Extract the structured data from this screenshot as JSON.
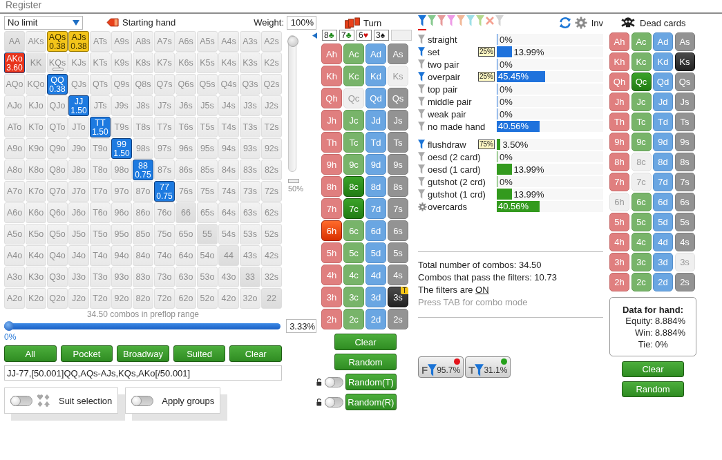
{
  "menu": {
    "item": "Register"
  },
  "range_panel": {
    "limit_dropdown": "No limit",
    "starting_hand": "Starting hand",
    "weight_label": "Weight:",
    "weight_value": "100%",
    "weight_slider": {
      "level": 1
    },
    "mini_bar": {
      "reading": "50%"
    },
    "hand_grid": {
      "rows": [
        [
          {
            "label": "AA",
            "selected": false
          },
          {
            "label": "AKs",
            "selected": false
          },
          {
            "label": "AQs",
            "selected": true,
            "weight": "0.38",
            "color": "#f3c41a"
          },
          {
            "label": "AJs",
            "selected": true,
            "weight": "0.38",
            "color": "#f3c41a"
          },
          {
            "label": "ATs",
            "selected": false
          },
          {
            "label": "A9s",
            "selected": false
          },
          {
            "label": "A8s",
            "selected": false
          },
          {
            "label": "A7s",
            "selected": false
          },
          {
            "label": "A6s",
            "selected": false
          },
          {
            "label": "A5s",
            "selected": false
          },
          {
            "label": "A4s",
            "selected": false
          },
          {
            "label": "A3s",
            "selected": false
          },
          {
            "label": "A2s",
            "selected": false
          }
        ],
        [
          {
            "label": "AKo",
            "selected": true,
            "weight": "3.60",
            "color": "#e8341c"
          },
          {
            "label": "KK",
            "selected": false
          },
          {
            "label": "KQs",
            "selected": false,
            "level": 0
          },
          {
            "label": "KJs",
            "selected": false
          },
          {
            "label": "KTs",
            "selected": false
          },
          {
            "label": "K9s",
            "selected": false
          },
          {
            "label": "K8s",
            "selected": false
          },
          {
            "label": "K7s",
            "selected": false
          },
          {
            "label": "K6s",
            "selected": false
          },
          {
            "label": "K5s",
            "selected": false
          },
          {
            "label": "K4s",
            "selected": false
          },
          {
            "label": "K3s",
            "selected": false
          },
          {
            "label": "K2s",
            "selected": false
          }
        ],
        [
          {
            "label": "AQo",
            "selected": false
          },
          {
            "label": "KQo",
            "selected": false
          },
          {
            "label": "QQ",
            "selected": true,
            "weight": "0.38",
            "color": "#1d7ae0"
          },
          {
            "label": "QJs",
            "selected": false
          },
          {
            "label": "QTs",
            "selected": false
          },
          {
            "label": "Q9s",
            "selected": false
          },
          {
            "label": "Q8s",
            "selected": false
          },
          {
            "label": "Q7s",
            "selected": false
          },
          {
            "label": "Q6s",
            "selected": false
          },
          {
            "label": "Q5s",
            "selected": false
          },
          {
            "label": "Q4s",
            "selected": false
          },
          {
            "label": "Q3s",
            "selected": false
          },
          {
            "label": "Q2s",
            "selected": false
          }
        ],
        [
          {
            "label": "AJo",
            "selected": false
          },
          {
            "label": "KJo",
            "selected": false
          },
          {
            "label": "QJo",
            "selected": false
          },
          {
            "label": "JJ",
            "selected": true,
            "weight": "1.50",
            "color": "#1d7ae0"
          },
          {
            "label": "JTs",
            "selected": false
          },
          {
            "label": "J9s",
            "selected": false
          },
          {
            "label": "J8s",
            "selected": false
          },
          {
            "label": "J7s",
            "selected": false
          },
          {
            "label": "J6s",
            "selected": false
          },
          {
            "label": "J5s",
            "selected": false
          },
          {
            "label": "J4s",
            "selected": false
          },
          {
            "label": "J3s",
            "selected": false
          },
          {
            "label": "J2s",
            "selected": false
          }
        ],
        [
          {
            "label": "ATo",
            "selected": false
          },
          {
            "label": "KTo",
            "selected": false
          },
          {
            "label": "QTo",
            "selected": false
          },
          {
            "label": "JTo",
            "selected": false
          },
          {
            "label": "TT",
            "selected": true,
            "weight": "1.50",
            "color": "#1d7ae0"
          },
          {
            "label": "T9s",
            "selected": false
          },
          {
            "label": "T8s",
            "selected": false
          },
          {
            "label": "T7s",
            "selected": false
          },
          {
            "label": "T6s",
            "selected": false
          },
          {
            "label": "T5s",
            "selected": false
          },
          {
            "label": "T4s",
            "selected": false
          },
          {
            "label": "T3s",
            "selected": false
          },
          {
            "label": "T2s",
            "selected": false
          }
        ],
        [
          {
            "label": "A9o",
            "selected": false
          },
          {
            "label": "K9o",
            "selected": false
          },
          {
            "label": "Q9o",
            "selected": false
          },
          {
            "label": "J9o",
            "selected": false
          },
          {
            "label": "T9o",
            "selected": false
          },
          {
            "label": "99",
            "selected": true,
            "weight": "1.50",
            "color": "#1d7ae0"
          },
          {
            "label": "98s",
            "selected": false
          },
          {
            "label": "97s",
            "selected": false
          },
          {
            "label": "96s",
            "selected": false
          },
          {
            "label": "95s",
            "selected": false
          },
          {
            "label": "94s",
            "selected": false
          },
          {
            "label": "93s",
            "selected": false
          },
          {
            "label": "92s",
            "selected": false
          }
        ],
        [
          {
            "label": "A8o",
            "selected": false
          },
          {
            "label": "K8o",
            "selected": false
          },
          {
            "label": "Q8o",
            "selected": false
          },
          {
            "label": "J8o",
            "selected": false
          },
          {
            "label": "T8o",
            "selected": false
          },
          {
            "label": "98o",
            "selected": false
          },
          {
            "label": "88",
            "selected": true,
            "weight": "0.75",
            "color": "#1d7ae0"
          },
          {
            "label": "87s",
            "selected": false
          },
          {
            "label": "86s",
            "selected": false
          },
          {
            "label": "85s",
            "selected": false
          },
          {
            "label": "84s",
            "selected": false
          },
          {
            "label": "83s",
            "selected": false
          },
          {
            "label": "82s",
            "selected": false
          }
        ],
        [
          {
            "label": "A7o",
            "selected": false
          },
          {
            "label": "K7o",
            "selected": false
          },
          {
            "label": "Q7o",
            "selected": false
          },
          {
            "label": "J7o",
            "selected": false
          },
          {
            "label": "T7o",
            "selected": false
          },
          {
            "label": "97o",
            "selected": false
          },
          {
            "label": "87o",
            "selected": false
          },
          {
            "label": "77",
            "selected": true,
            "weight": "0.75",
            "color": "#1d7ae0"
          },
          {
            "label": "76s",
            "selected": false
          },
          {
            "label": "75s",
            "selected": false
          },
          {
            "label": "74s",
            "selected": false
          },
          {
            "label": "73s",
            "selected": false
          },
          {
            "label": "72s",
            "selected": false
          }
        ],
        [
          {
            "label": "A6o",
            "selected": false
          },
          {
            "label": "K6o",
            "selected": false
          },
          {
            "label": "Q6o",
            "selected": false
          },
          {
            "label": "J6o",
            "selected": false
          },
          {
            "label": "T6o",
            "selected": false
          },
          {
            "label": "96o",
            "selected": false
          },
          {
            "label": "86o",
            "selected": false
          },
          {
            "label": "76o",
            "selected": false
          },
          {
            "label": "66",
            "selected": false
          },
          {
            "label": "65s",
            "selected": false
          },
          {
            "label": "64s",
            "selected": false
          },
          {
            "label": "63s",
            "selected": false
          },
          {
            "label": "62s",
            "selected": false
          }
        ],
        [
          {
            "label": "A5o",
            "selected": false
          },
          {
            "label": "K5o",
            "selected": false
          },
          {
            "label": "Q5o",
            "selected": false
          },
          {
            "label": "J5o",
            "selected": false
          },
          {
            "label": "T5o",
            "selected": false
          },
          {
            "label": "95o",
            "selected": false
          },
          {
            "label": "85o",
            "selected": false
          },
          {
            "label": "75o",
            "selected": false
          },
          {
            "label": "65o",
            "selected": false
          },
          {
            "label": "55",
            "selected": false
          },
          {
            "label": "54s",
            "selected": false
          },
          {
            "label": "53s",
            "selected": false
          },
          {
            "label": "52s",
            "selected": false
          }
        ],
        [
          {
            "label": "A4o",
            "selected": false
          },
          {
            "label": "K4o",
            "selected": false
          },
          {
            "label": "Q4o",
            "selected": false
          },
          {
            "label": "J4o",
            "selected": false
          },
          {
            "label": "T4o",
            "selected": false
          },
          {
            "label": "94o",
            "selected": false
          },
          {
            "label": "84o",
            "selected": false
          },
          {
            "label": "74o",
            "selected": false
          },
          {
            "label": "64o",
            "selected": false
          },
          {
            "label": "54o",
            "selected": false
          },
          {
            "label": "44",
            "selected": false
          },
          {
            "label": "43s",
            "selected": false
          },
          {
            "label": "42s",
            "selected": false
          }
        ],
        [
          {
            "label": "A3o",
            "selected": false
          },
          {
            "label": "K3o",
            "selected": false
          },
          {
            "label": "Q3o",
            "selected": false
          },
          {
            "label": "J3o",
            "selected": false
          },
          {
            "label": "T3o",
            "selected": false
          },
          {
            "label": "93o",
            "selected": false
          },
          {
            "label": "83o",
            "selected": false
          },
          {
            "label": "73o",
            "selected": false
          },
          {
            "label": "63o",
            "selected": false
          },
          {
            "label": "53o",
            "selected": false
          },
          {
            "label": "43o",
            "selected": false
          },
          {
            "label": "33",
            "selected": false
          },
          {
            "label": "32s",
            "selected": false
          }
        ],
        [
          {
            "label": "A2o",
            "selected": false
          },
          {
            "label": "K2o",
            "selected": false
          },
          {
            "label": "Q2o",
            "selected": false
          },
          {
            "label": "J2o",
            "selected": false
          },
          {
            "label": "T2o",
            "selected": false
          },
          {
            "label": "92o",
            "selected": false
          },
          {
            "label": "82o",
            "selected": false
          },
          {
            "label": "72o",
            "selected": false
          },
          {
            "label": "62o",
            "selected": false
          },
          {
            "label": "52o",
            "selected": false
          },
          {
            "label": "42o",
            "selected": false
          },
          {
            "label": "32o",
            "selected": false
          },
          {
            "label": "22",
            "selected": false
          }
        ]
      ]
    },
    "combo_caption": "34.50 combos in preflop range",
    "range_slider": {
      "level": 0
    },
    "slider_reading": "0%",
    "percent_field": "3.33%",
    "buttons": [
      "All",
      "Pocket",
      "Broadway",
      "Suited",
      "Clear"
    ],
    "range_text": "JJ-77,[50.001]QQ,AQs-AJs,KQs,AKo[/50.001]",
    "toggles": [
      {
        "label": "Suit selection",
        "on": false,
        "kind": "suits"
      },
      {
        "label": "Apply groups",
        "on": false,
        "kind": "plain"
      }
    ]
  },
  "board": {
    "street": "Turn",
    "cards": [
      {
        "rank": "8",
        "suit": "♣",
        "kind": "clubs"
      },
      {
        "rank": "7",
        "suit": "♣",
        "kind": "clubs"
      },
      {
        "rank": "6",
        "suit": "♥",
        "kind": "hearts"
      },
      {
        "rank": "3",
        "suit": "♠",
        "kind": "spades"
      },
      {
        "kind": "empty"
      }
    ],
    "deck": {
      "suits": [
        {
          "kind": "hearts",
          "cards": [
            {
              "label": "Ah",
              "kind": "free"
            },
            {
              "label": "Kh",
              "kind": "free"
            },
            {
              "label": "Qh",
              "kind": "free"
            },
            {
              "label": "Jh",
              "kind": "free"
            },
            {
              "label": "Th",
              "kind": "free"
            },
            {
              "label": "9h",
              "kind": "free"
            },
            {
              "label": "8h",
              "kind": "free"
            },
            {
              "label": "7h",
              "kind": "free"
            },
            {
              "label": "6h",
              "kind": "board"
            },
            {
              "label": "5h",
              "kind": "free"
            },
            {
              "label": "4h",
              "kind": "free"
            },
            {
              "label": "3h",
              "kind": "free"
            },
            {
              "label": "2h",
              "kind": "free"
            }
          ]
        },
        {
          "kind": "clubs",
          "cards": [
            {
              "label": "Ac",
              "kind": "free"
            },
            {
              "label": "Kc",
              "kind": "free"
            },
            {
              "label": "Qc",
              "kind": "used"
            },
            {
              "label": "Jc",
              "kind": "free"
            },
            {
              "label": "Tc",
              "kind": "free"
            },
            {
              "label": "9c",
              "kind": "free"
            },
            {
              "label": "8c",
              "kind": "board"
            },
            {
              "label": "7c",
              "kind": "board"
            },
            {
              "label": "6c",
              "kind": "free"
            },
            {
              "label": "5c",
              "kind": "free"
            },
            {
              "label": "4c",
              "kind": "free"
            },
            {
              "label": "3c",
              "kind": "free"
            },
            {
              "label": "2c",
              "kind": "free"
            }
          ]
        },
        {
          "kind": "diamonds",
          "cards": [
            {
              "label": "Ad",
              "kind": "free"
            },
            {
              "label": "Kd",
              "kind": "free"
            },
            {
              "label": "Qd",
              "kind": "free"
            },
            {
              "label": "Jd",
              "kind": "free"
            },
            {
              "label": "Td",
              "kind": "free"
            },
            {
              "label": "9d",
              "kind": "free"
            },
            {
              "label": "8d",
              "kind": "free"
            },
            {
              "label": "7d",
              "kind": "free"
            },
            {
              "label": "6d",
              "kind": "free"
            },
            {
              "label": "5d",
              "kind": "free"
            },
            {
              "label": "4d",
              "kind": "free"
            },
            {
              "label": "3d",
              "kind": "free"
            },
            {
              "label": "2d",
              "kind": "free"
            }
          ]
        },
        {
          "kind": "spades",
          "cards": [
            {
              "label": "As",
              "kind": "free"
            },
            {
              "label": "Ks",
              "kind": "used"
            },
            {
              "label": "Qs",
              "kind": "free"
            },
            {
              "label": "Js",
              "kind": "free"
            },
            {
              "label": "Ts",
              "kind": "free"
            },
            {
              "label": "9s",
              "kind": "free"
            },
            {
              "label": "8s",
              "kind": "free"
            },
            {
              "label": "7s",
              "kind": "free"
            },
            {
              "label": "6s",
              "kind": "free"
            },
            {
              "label": "5s",
              "kind": "free"
            },
            {
              "label": "4s",
              "kind": "free"
            },
            {
              "label": "3s",
              "kind": "board",
              "badge": "T"
            },
            {
              "label": "2s",
              "kind": "free"
            }
          ]
        }
      ]
    },
    "buttons": [
      {
        "label": "Clear",
        "lock": false
      },
      {
        "label": "Random",
        "lock": false
      },
      {
        "label": "Random(T)",
        "lock": true,
        "on": false
      },
      {
        "label": "Random(R)",
        "lock": true,
        "on": false
      }
    ]
  },
  "filters": {
    "tabs": [
      {
        "kind": "funnel",
        "color": "#1a73d6",
        "selected": true
      },
      {
        "kind": "funnel",
        "color": "#86c98e",
        "selected": false
      },
      {
        "kind": "funnel",
        "color": "#e79a9a",
        "selected": false
      },
      {
        "kind": "funnel",
        "color": "#ee9ae6",
        "selected": false
      },
      {
        "kind": "funnel",
        "color": "#f1b898",
        "selected": false
      },
      {
        "kind": "funnel",
        "color": "#9ddfe6",
        "selected": false
      },
      {
        "kind": "funnel",
        "color": "#b6da8e",
        "selected": false
      },
      {
        "kind": "clear",
        "color": "#f5a090",
        "selected": false
      },
      {
        "kind": "funnel",
        "color": "#d4d4d4",
        "selected": false
      }
    ],
    "inv": "Inv",
    "groups": [
      {
        "color": "#1f72dc",
        "rows": [
          {
            "kind": "funnel",
            "label": "straight",
            "active": false,
            "level": 0,
            "reading": "0%"
          },
          {
            "kind": "funnel",
            "label": "set",
            "active": true,
            "badge": "25%",
            "level": 0.1399,
            "reading": "13.99%"
          },
          {
            "kind": "funnel",
            "label": "two pair",
            "active": false,
            "level": 0,
            "reading": "0%"
          },
          {
            "kind": "funnel",
            "label": "overpair",
            "active": true,
            "badge": "25%",
            "level": 0.4545,
            "reading": "45.45%"
          },
          {
            "kind": "funnel",
            "label": "top pair",
            "active": false,
            "level": 0,
            "reading": "0%"
          },
          {
            "kind": "funnel",
            "label": "middle pair",
            "active": false,
            "level": 0,
            "reading": "0%"
          },
          {
            "kind": "funnel",
            "label": "weak pair",
            "active": false,
            "level": 0,
            "reading": "0%"
          },
          {
            "kind": "funnel",
            "label": "no made hand",
            "active": false,
            "level": 0.4056,
            "reading": "40.56%"
          }
        ]
      },
      {
        "color": "#339a1e",
        "rows": [
          {
            "kind": "funnel",
            "label": "flushdraw",
            "active": true,
            "badge": "75%",
            "level": 0.035,
            "reading": "3.50%"
          },
          {
            "kind": "funnel",
            "label": "oesd (2 card)",
            "active": false,
            "level": 0,
            "reading": "0%"
          },
          {
            "kind": "funnel",
            "label": "oesd (1 card)",
            "active": false,
            "level": 0.1399,
            "reading": "13.99%"
          },
          {
            "kind": "funnel",
            "label": "gutshot (2 crd)",
            "active": false,
            "level": 0,
            "reading": "0%"
          },
          {
            "kind": "funnel",
            "label": "gutshot (1 crd)",
            "active": false,
            "level": 0.1399,
            "reading": "13.99%"
          },
          {
            "kind": "gear",
            "label": "overcards",
            "level": 0.4056,
            "reading": "40.56%"
          }
        ]
      }
    ],
    "total_combos": "Total number of combos: 34.50",
    "passing_combos": "Combos that pass the filters: 10.73",
    "filters_prefix": "The filters are",
    "filters_state": "ON",
    "hint": "Press TAB for combo mode",
    "badges": [
      {
        "letter": "F",
        "reading": "95.7%",
        "color": "#e3141c"
      },
      {
        "letter": "T",
        "reading": "31.1%",
        "color": "#25a11b"
      }
    ]
  },
  "dead_cards": {
    "title": "Dead cards",
    "deck": {
      "suits": [
        {
          "kind": "hearts",
          "cards": [
            {
              "label": "Ah",
              "kind": "free"
            },
            {
              "label": "Kh",
              "kind": "free"
            },
            {
              "label": "Qh",
              "kind": "free"
            },
            {
              "label": "Jh",
              "kind": "free"
            },
            {
              "label": "Th",
              "kind": "free"
            },
            {
              "label": "9h",
              "kind": "free"
            },
            {
              "label": "8h",
              "kind": "free"
            },
            {
              "label": "7h",
              "kind": "free"
            },
            {
              "label": "6h",
              "kind": "used"
            },
            {
              "label": "5h",
              "kind": "free"
            },
            {
              "label": "4h",
              "kind": "free"
            },
            {
              "label": "3h",
              "kind": "free"
            },
            {
              "label": "2h",
              "kind": "free"
            }
          ]
        },
        {
          "kind": "clubs",
          "cards": [
            {
              "label": "Ac",
              "kind": "free"
            },
            {
              "label": "Kc",
              "kind": "free"
            },
            {
              "label": "Qc",
              "kind": "dead"
            },
            {
              "label": "Jc",
              "kind": "free"
            },
            {
              "label": "Tc",
              "kind": "free"
            },
            {
              "label": "9c",
              "kind": "free"
            },
            {
              "label": "8c",
              "kind": "used"
            },
            {
              "label": "7c",
              "kind": "used"
            },
            {
              "label": "6c",
              "kind": "free"
            },
            {
              "label": "5c",
              "kind": "free"
            },
            {
              "label": "4c",
              "kind": "free"
            },
            {
              "label": "3c",
              "kind": "free"
            },
            {
              "label": "2c",
              "kind": "free"
            }
          ]
        },
        {
          "kind": "diamonds",
          "cards": [
            {
              "label": "Ad",
              "kind": "free"
            },
            {
              "label": "Kd",
              "kind": "free"
            },
            {
              "label": "Qd",
              "kind": "free"
            },
            {
              "label": "Jd",
              "kind": "free"
            },
            {
              "label": "Td",
              "kind": "free"
            },
            {
              "label": "9d",
              "kind": "free"
            },
            {
              "label": "8d",
              "kind": "free"
            },
            {
              "label": "7d",
              "kind": "free"
            },
            {
              "label": "6d",
              "kind": "free"
            },
            {
              "label": "5d",
              "kind": "free"
            },
            {
              "label": "4d",
              "kind": "free"
            },
            {
              "label": "3d",
              "kind": "free"
            },
            {
              "label": "2d",
              "kind": "free"
            }
          ]
        },
        {
          "kind": "spades",
          "cards": [
            {
              "label": "As",
              "kind": "free"
            },
            {
              "label": "Ks",
              "kind": "dead"
            },
            {
              "label": "Qs",
              "kind": "free"
            },
            {
              "label": "Js",
              "kind": "free"
            },
            {
              "label": "Ts",
              "kind": "free"
            },
            {
              "label": "9s",
              "kind": "free"
            },
            {
              "label": "8s",
              "kind": "free"
            },
            {
              "label": "7s",
              "kind": "free"
            },
            {
              "label": "6s",
              "kind": "free"
            },
            {
              "label": "5s",
              "kind": "free"
            },
            {
              "label": "4s",
              "kind": "free"
            },
            {
              "label": "3s",
              "kind": "used"
            },
            {
              "label": "2s",
              "kind": "free"
            }
          ]
        }
      ]
    },
    "hand_data": {
      "title": "Data for hand:",
      "lines": [
        {
          "label": "Equity:",
          "value": "8.884%"
        },
        {
          "label": "Win:",
          "value": "8.884%"
        },
        {
          "label": "Tie:",
          "value": "0%"
        }
      ]
    },
    "buttons": [
      "Clear",
      "Random"
    ]
  }
}
